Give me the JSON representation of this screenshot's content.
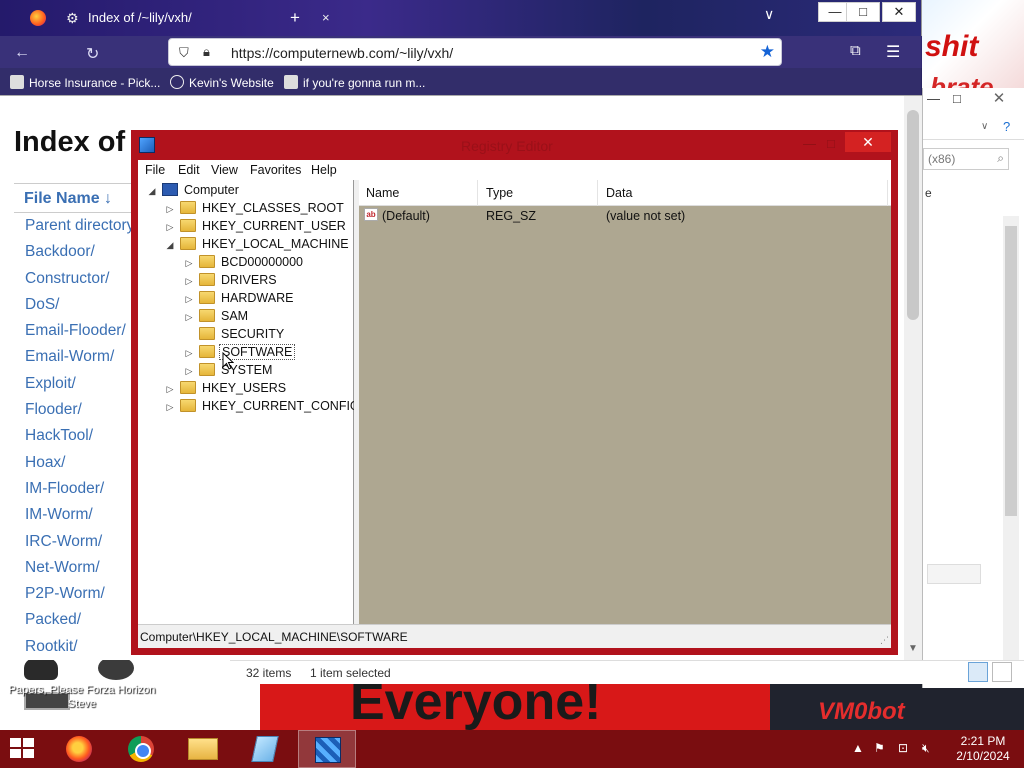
{
  "browser": {
    "tab_title": "Index of /~lily/vxh/",
    "tab_close": "×",
    "new_tab": "+",
    "url": "https://computernewb.com/~lily/vxh/",
    "bookmarks": [
      {
        "label": "Horse Insurance - Pick..."
      },
      {
        "label": "Kevin's Website"
      },
      {
        "label": "if you're gonna run m..."
      }
    ],
    "window_buttons": {
      "minimize": "—",
      "maximize": "□",
      "close": "✕"
    }
  },
  "index_page": {
    "title": "Index of /~lily/vxh/",
    "column_header": "File Name  ↓",
    "rows": [
      "Parent directory/",
      "Backdoor/",
      "Constructor/",
      "DoS/",
      "Email-Flooder/",
      "Email-Worm/",
      "Exploit/",
      "Flooder/",
      "HackTool/",
      "Hoax/",
      "IM-Flooder/",
      "IM-Worm/",
      "IRC-Worm/",
      "Net-Worm/",
      "P2P-Worm/",
      "Packed/",
      "Rootkit/"
    ]
  },
  "explorer": {
    "search_placeholder": "(x86)",
    "column_fragment": "e",
    "status_items": "32 items",
    "status_selected": "1 item selected"
  },
  "regedit": {
    "title": "Registry Editor",
    "menu": [
      "File",
      "Edit",
      "View",
      "Favorites",
      "Help"
    ],
    "tree": {
      "root": "Computer",
      "hives": [
        "HKEY_CLASSES_ROOT",
        "HKEY_CURRENT_USER",
        "HKEY_LOCAL_MACHINE"
      ],
      "hklm_children": [
        "BCD00000000",
        "DRIVERS",
        "HARDWARE",
        "SAM",
        "SECURITY",
        "SOFTWARE",
        "SYSTEM"
      ],
      "more_hives": [
        "HKEY_USERS",
        "HKEY_CURRENT_CONFIG"
      ]
    },
    "columns": {
      "name": "Name",
      "type": "Type",
      "data": "Data"
    },
    "values": [
      {
        "name": "(Default)",
        "type": "REG_SZ",
        "data": "(value not set)"
      }
    ],
    "status_path": "Computer\\HKEY_LOCAL_MACHINE\\SOFTWARE"
  },
  "desktop": {
    "icon_label": "Papers, Please Forza Horizon Steve",
    "wallpaper_text_main": "Everyone!",
    "wallpaper_text_corner": "VM0bot",
    "wallpaper_sign": "shit",
    "wallpaper_sign2": "brate"
  },
  "taskbar": {
    "time": "2:21 PM",
    "date": "2/10/2024"
  },
  "colors": {
    "regedit_frame": "#b1121c",
    "taskbar": "#7a0d10",
    "link": "#3a6fb3"
  }
}
